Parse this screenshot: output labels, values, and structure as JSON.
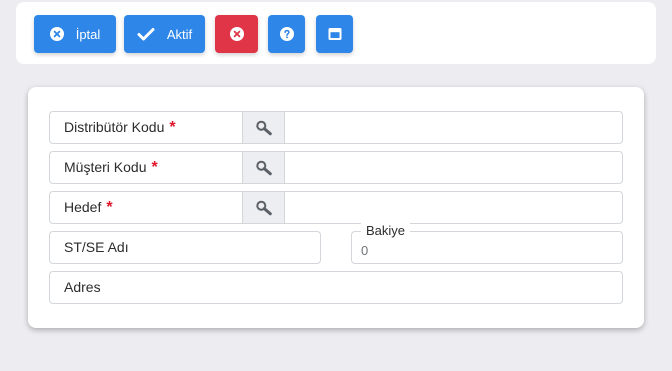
{
  "toolbar": {
    "cancel_label": "İptal",
    "active_label": "Aktif",
    "icons": {
      "cancel": "close-circle-icon",
      "active": "check-icon",
      "delete": "close-circle-icon",
      "help": "question-circle-icon",
      "window": "window-icon"
    }
  },
  "form": {
    "distributor_code": {
      "label": "Distribütör Kodu",
      "required_mark": "*",
      "value": ""
    },
    "customer_code": {
      "label": "Müşteri Kodu",
      "required_mark": "*",
      "value": ""
    },
    "target": {
      "label": "Hedef",
      "required_mark": "*",
      "value": ""
    },
    "st_se_name": {
      "label": "ST/SE Adı"
    },
    "balance": {
      "legend": "Bakiye",
      "value": "0"
    },
    "address": {
      "label": "Adres"
    }
  },
  "colors": {
    "primary": "#2e86e8",
    "danger": "#df3546",
    "required": "#e0172a",
    "background": "#ededf1"
  }
}
